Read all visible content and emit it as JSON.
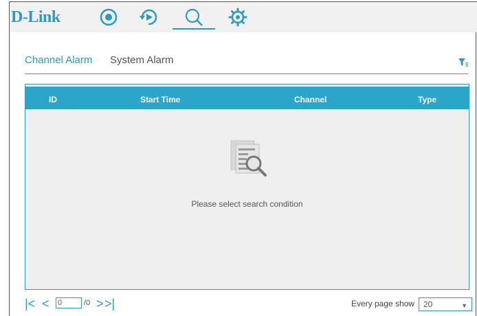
{
  "app": {
    "logo": "D-Link"
  },
  "nav": {
    "icons": [
      "live-view-icon",
      "playback-icon",
      "search-icon",
      "settings-icon"
    ],
    "active": "search-icon"
  },
  "tabs": {
    "channel_alarm": "Channel Alarm",
    "system_alarm": "System Alarm",
    "active": "Channel Alarm"
  },
  "table": {
    "columns": [
      "ID",
      "Start Time",
      "Channel",
      "Type"
    ],
    "rows": [],
    "empty_message": "Please select search condition"
  },
  "pager": {
    "current_page": "0",
    "total": "/0",
    "page_size_label": "Every page show",
    "page_size": "20"
  },
  "colors": {
    "accent": "#2b9cbf",
    "header_bg": "#2ba5c9",
    "body_bg": "#efefef",
    "topbar_bg": "#f1f1f1"
  }
}
